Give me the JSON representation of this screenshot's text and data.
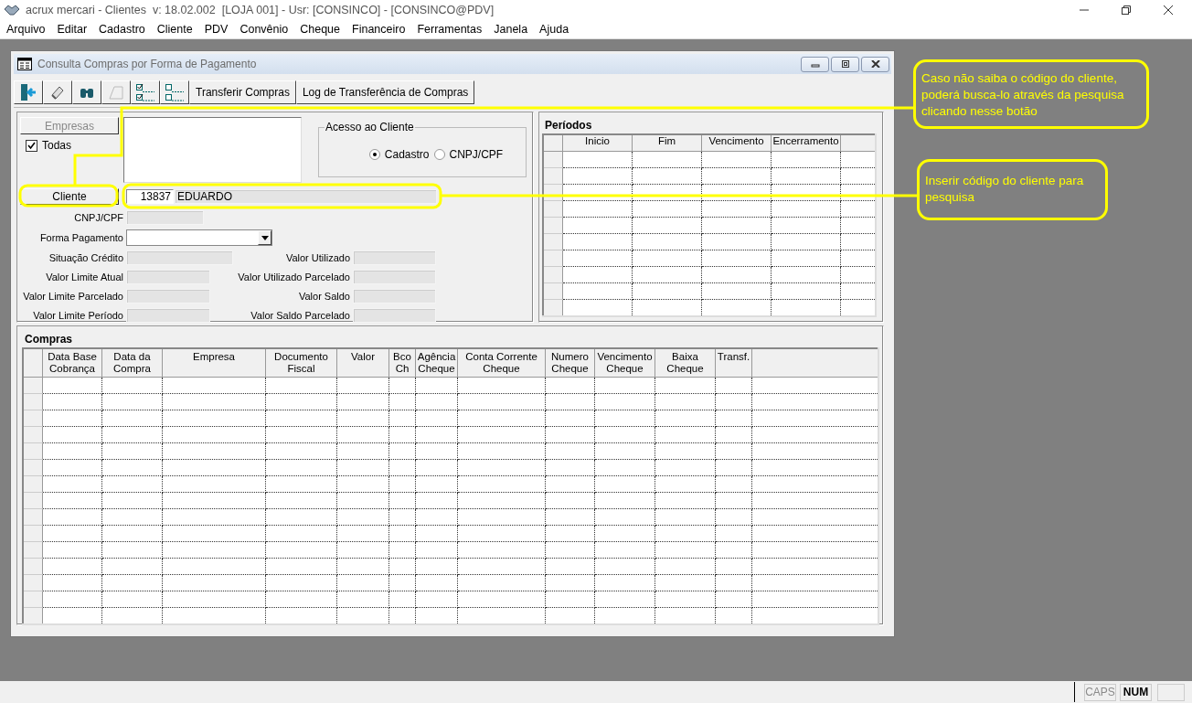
{
  "app_title": "acrux mercari - Clientes  v: 18.02.002  [LOJA 001] - Usr: [CONSINCO] - [CONSINCO@PDV]",
  "menu": [
    "Arquivo",
    "Editar",
    "Cadastro",
    "Cliente",
    "PDV",
    "Convênio",
    "Cheque",
    "Financeiro",
    "Ferramentas",
    "Janela",
    "Ajuda"
  ],
  "window": {
    "title": "Consulta Compras por Forma de Pagamento"
  },
  "toolbar": [
    {
      "kind": "exit"
    },
    {
      "kind": "eraser"
    },
    {
      "kind": "search"
    },
    {
      "kind": "shape"
    },
    {
      "kind": "check_all"
    },
    {
      "kind": "uncheck_all"
    },
    {
      "kind": "text",
      "label": "Transferir Compras"
    },
    {
      "kind": "text",
      "label": "Log de Transferência de Compras"
    }
  ],
  "empresas": {
    "button": "Empresas",
    "disabled": true,
    "todas": {
      "label": "Todas",
      "checked": true
    }
  },
  "acesso": {
    "title": "Acesso ao Cliente",
    "options": [
      {
        "label": "Cadastro",
        "selected": true
      },
      {
        "label": "CNPJ/CPF",
        "selected": false
      }
    ]
  },
  "cliente": {
    "button": "Cliente",
    "code": "13837",
    "name": "EDUARDO"
  },
  "fields": [
    {
      "label": "CNPJ/CPF",
      "kind": "text"
    },
    {
      "label": "Forma Pagamento",
      "kind": "select"
    },
    {
      "label": "Situação Crédito",
      "kind": "text"
    },
    {
      "label": "Valor Limite Atual",
      "kind": "text"
    },
    {
      "label": "Valor Limite Parcelado",
      "kind": "text"
    },
    {
      "label": "Valor Limite Período",
      "kind": "text"
    }
  ],
  "fields_right": [
    {
      "label": "Valor Utilizado",
      "kind": "text"
    },
    {
      "label": "Valor Utilizado Parcelado",
      "kind": "text"
    },
    {
      "label": "Valor Saldo",
      "kind": "text"
    },
    {
      "label": "Valor Saldo Parcelado",
      "kind": "text"
    }
  ],
  "periodos": {
    "title": "Períodos",
    "columns": [
      "Inicio",
      "Fim",
      "Vencimento",
      "Encerramento"
    ]
  },
  "compras": {
    "title": "Compras",
    "columns": [
      {
        "lines": [
          "Data Base",
          "Cobrança"
        ]
      },
      {
        "lines": [
          "Data da",
          "Compra"
        ]
      },
      {
        "lines": [
          "Empresa"
        ]
      },
      {
        "lines": [
          "Documento",
          "Fiscal"
        ]
      },
      {
        "lines": [
          "Valor"
        ]
      },
      {
        "lines": [
          "Bco",
          "Ch"
        ]
      },
      {
        "lines": [
          "Agência",
          "Cheque"
        ]
      },
      {
        "lines": [
          "Conta Corrente",
          "Cheque"
        ]
      },
      {
        "lines": [
          "Numero",
          "Cheque"
        ]
      },
      {
        "lines": [
          "Vencimento",
          "Cheque"
        ]
      },
      {
        "lines": [
          "Baixa",
          "Cheque"
        ]
      },
      {
        "lines": [
          "Transf."
        ]
      }
    ]
  },
  "callouts": [
    "Caso não saiba o código do cliente, poderá busca-lo através da pesquisa clicando nesse botão",
    "Inserir código do cliente para pesquisa"
  ],
  "status_bar": [
    {
      "label": "CAPS",
      "on": false
    },
    {
      "label": "NUM",
      "on": true
    }
  ]
}
